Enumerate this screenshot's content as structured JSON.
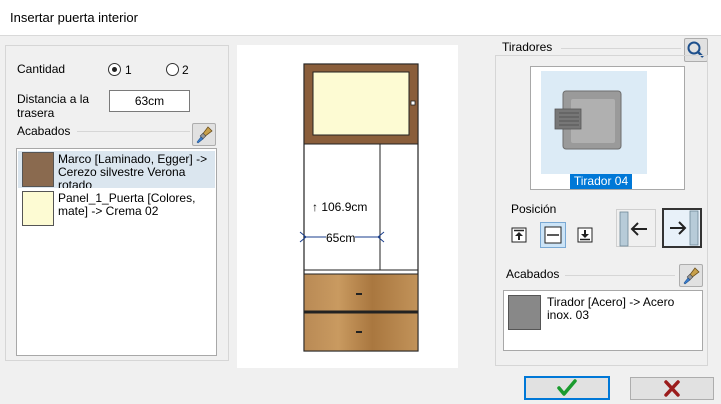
{
  "window": {
    "title": "Insertar puerta interior"
  },
  "left": {
    "cantidad_label": "Cantidad",
    "cantidad_options": [
      "1",
      "2"
    ],
    "cantidad_selected": "1",
    "distancia_label_1": "Distancia a la",
    "distancia_label_2": "trasera",
    "distancia_value": "63cm",
    "acabados_label": "Acabados",
    "acabados_items": [
      {
        "text": "Marco [Laminado, Egger] -> Cerezo silvestre Verona rotado",
        "color": "#8a6a4f"
      },
      {
        "text": "Panel_1_Puerta [Colores, mate] -> Crema 02",
        "color": "#fdfbd3"
      }
    ]
  },
  "preview": {
    "height_label": "↑ 106.9cm",
    "width_label": "65cm"
  },
  "right": {
    "tiradores_label": "Tiradores",
    "tirador_name": "Tirador 04",
    "posicion_label": "Posición",
    "acabados_label": "Acabados",
    "acabados_item": {
      "text": "Tirador [Acero] -> Acero inox. 03",
      "color": "#888888"
    }
  },
  "colors": {
    "accent": "#0078d7",
    "ok": "#1a9b2e",
    "cancel": "#9b1c1c",
    "wood": "#b4844e"
  },
  "icons": {
    "search": "search-icon",
    "brush": "paintbrush-icon",
    "ok": "checkmark-icon",
    "cancel": "x-icon"
  }
}
